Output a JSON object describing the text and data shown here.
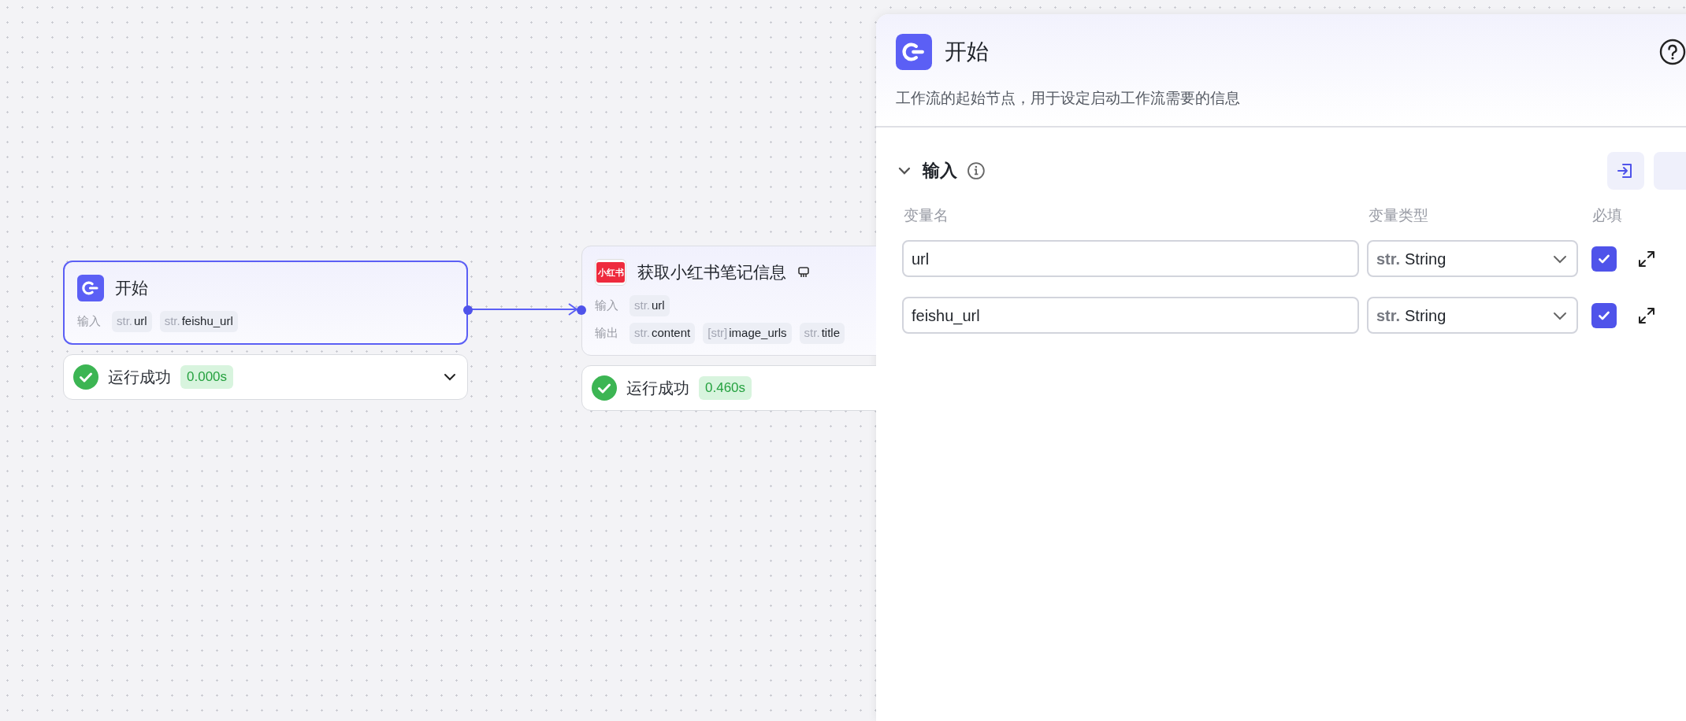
{
  "nodes": [
    {
      "title": "开始",
      "kind": "start",
      "selected": true,
      "rows": [
        {
          "label": "输入",
          "vars": [
            {
              "type": "str.",
              "name": "url"
            },
            {
              "type": "str.",
              "name": "feishu_url"
            }
          ]
        }
      ],
      "status": {
        "text": "运行成功",
        "time": "0.000s"
      }
    },
    {
      "title": "获取小红书笔记信息",
      "kind": "plugin",
      "logo_text": "小红书",
      "rows": [
        {
          "label": "输入",
          "vars": [
            {
              "type": "str.",
              "name": "url"
            }
          ]
        },
        {
          "label": "输出",
          "vars": [
            {
              "type": "str.",
              "name": "content"
            },
            {
              "type": "[str]",
              "name": "image_urls"
            },
            {
              "type": "str.",
              "name": "title"
            }
          ]
        }
      ],
      "selected": false,
      "status": {
        "text": "运行成功",
        "time": "0.460s"
      }
    }
  ],
  "panel": {
    "title": "开始",
    "description": "工作流的起始节点，用于设定启动工作流需要的信息",
    "section": {
      "title": "输入",
      "expanded": true,
      "columns": [
        "变量名",
        "变量类型",
        "必填"
      ],
      "rows": [
        {
          "name": "url",
          "type_prefix": "str.",
          "type": "String",
          "required": true
        },
        {
          "name": "feishu_url",
          "type_prefix": "str.",
          "type": "String",
          "required": true
        }
      ]
    }
  }
}
